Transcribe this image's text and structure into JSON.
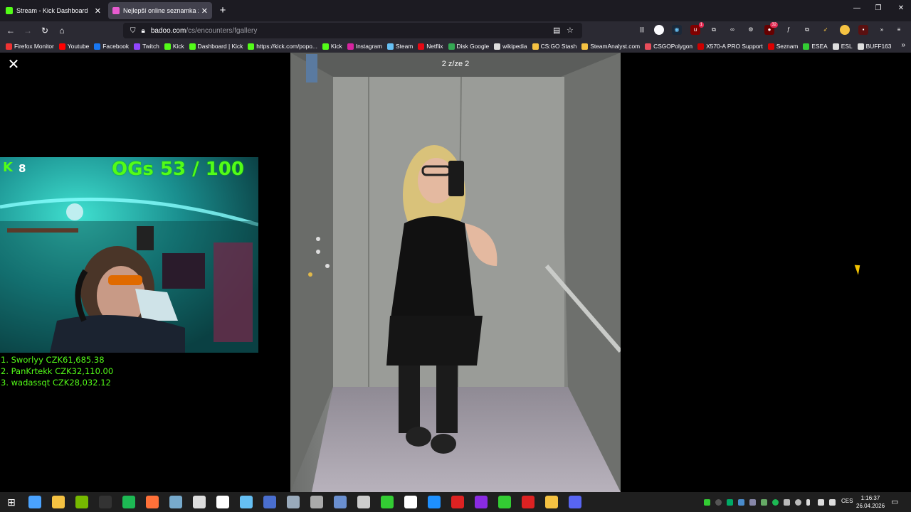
{
  "tabs": [
    {
      "title": "Stream - Kick Dashboard",
      "color": "#53fc18",
      "active": false
    },
    {
      "title": "Nejlepší online seznamka zdarm",
      "color": "#e85bd0",
      "active": true
    }
  ],
  "new_tab_label": "+",
  "url": {
    "host": "badoo.com",
    "path": "/cs/encounters/fgallery"
  },
  "extension_badges": {
    "ublock": "1",
    "notifications": "32"
  },
  "bookmarks": [
    {
      "label": "Firefox Monitor",
      "color": "#e33"
    },
    {
      "label": "Youtube",
      "color": "#f00"
    },
    {
      "label": "Facebook",
      "color": "#1877f2"
    },
    {
      "label": "Twitch",
      "color": "#9146ff"
    },
    {
      "label": "Kick",
      "color": "#53fc18"
    },
    {
      "label": "Dashboard | Kick",
      "color": "#53fc18"
    },
    {
      "label": "https://kick.com/popo...",
      "color": "#53fc18"
    },
    {
      "label": "Kick",
      "color": "#53fc18"
    },
    {
      "label": "Instagram",
      "color": "#d6249f"
    },
    {
      "label": "Steam",
      "color": "#66c0f4"
    },
    {
      "label": "Netflix",
      "color": "#e50914"
    },
    {
      "label": "Disk Google",
      "color": "#34a853"
    },
    {
      "label": "wikipedia",
      "color": "#ddd"
    },
    {
      "label": "CS:GO Stash",
      "color": "#f5c242"
    },
    {
      "label": "SteamAnalyst.com",
      "color": "#f5c242"
    },
    {
      "label": "CSGOPolygon",
      "color": "#e84d5b"
    },
    {
      "label": "X570-A PRO Support",
      "color": "#c00"
    },
    {
      "label": "Seznam",
      "color": "#d00"
    },
    {
      "label": "ESEA",
      "color": "#3c3"
    },
    {
      "label": "ESL",
      "color": "#ddd"
    },
    {
      "label": "BUFF163",
      "color": "#ddd"
    }
  ],
  "gallery": {
    "counter": "2 z/ze 2"
  },
  "stream_overlay": {
    "kick_logo": "K",
    "viewer_count": "8",
    "og_counter": "OGs 53 / 100",
    "leaderboard": [
      "1. Sworlyy CZK61,685.38",
      "2. PanKrtekk CZK32,110.00",
      "3. wadassqt CZK28,032.12"
    ]
  },
  "taskbar": {
    "language": "CES",
    "time": "1:16:37",
    "date": "26.04.2026",
    "apps": [
      "windows-icon",
      "widgets-icon",
      "file-explorer-icon",
      "nvidia-icon",
      "terminal-icon",
      "spotify-icon",
      "firefox-icon",
      "app-icon",
      "app-icon",
      "clock-icon",
      "steam-icon",
      "monitor-icon",
      "app-icon",
      "obs-icon",
      "calculator-icon",
      "app-icon",
      "app-icon",
      "kick-icon",
      "app-icon",
      "app-icon",
      "app-icon",
      "app-icon",
      "opera-icon",
      "app-icon",
      "discord-icon"
    ]
  }
}
